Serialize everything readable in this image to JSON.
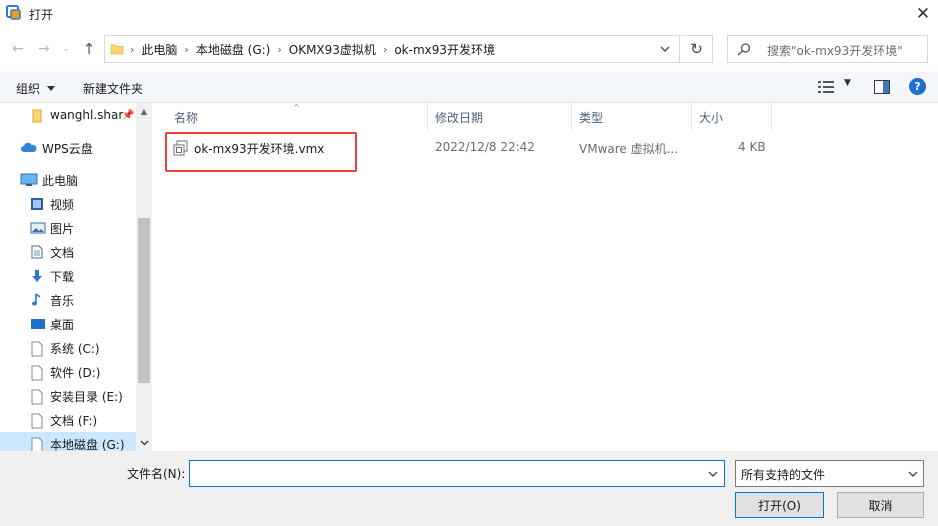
{
  "window": {
    "title": "打开",
    "close_label": "✕"
  },
  "address": {
    "crumbs": [
      "此电脑",
      "本地磁盘 (G:)",
      "OKMX93虚拟机",
      "ok-mx93开发环境"
    ],
    "separator": "›"
  },
  "search": {
    "placeholder": "搜索\"ok-mx93开发环境\""
  },
  "toolbar": {
    "organize_label": "组织",
    "new_folder_label": "新建文件夹",
    "help_label": "?"
  },
  "nav_pane": {
    "items": [
      {
        "label": "wanghl.shar",
        "icon": "folder-pinned-icon"
      },
      {
        "label": "WPS云盘",
        "icon": "cloud-icon"
      },
      {
        "label": "此电脑",
        "icon": "computer-icon"
      },
      {
        "label": "视频",
        "icon": "video-icon"
      },
      {
        "label": "图片",
        "icon": "pictures-icon"
      },
      {
        "label": "文档",
        "icon": "documents-icon"
      },
      {
        "label": "下载",
        "icon": "download-icon"
      },
      {
        "label": "音乐",
        "icon": "music-icon"
      },
      {
        "label": "桌面",
        "icon": "desktop-icon"
      },
      {
        "label": "系统 (C:)",
        "icon": "drive-icon"
      },
      {
        "label": "软件 (D:)",
        "icon": "drive-icon"
      },
      {
        "label": "安装目录 (E:)",
        "icon": "drive-icon"
      },
      {
        "label": "文档 (F:)",
        "icon": "drive-icon"
      },
      {
        "label": "本地磁盘 (G:)",
        "icon": "drive-icon",
        "selected": true
      }
    ]
  },
  "columns": {
    "name": "名称",
    "date": "修改日期",
    "type": "类型",
    "size": "大小"
  },
  "files": [
    {
      "name": "ok-mx93开发环境.vmx",
      "date": "2022/12/8 22:42",
      "type": "VMware 虚拟机...",
      "size": "4 KB",
      "highlighted": true
    }
  ],
  "bottom": {
    "filename_label": "文件名(N):",
    "filename_value": "",
    "filter_value": "所有支持的文件",
    "open_label": "打开(O)",
    "cancel_label": "取消"
  },
  "colors": {
    "accent": "#0078d7",
    "highlight_border": "#e8433f",
    "selected_bg": "#cce8ff"
  }
}
